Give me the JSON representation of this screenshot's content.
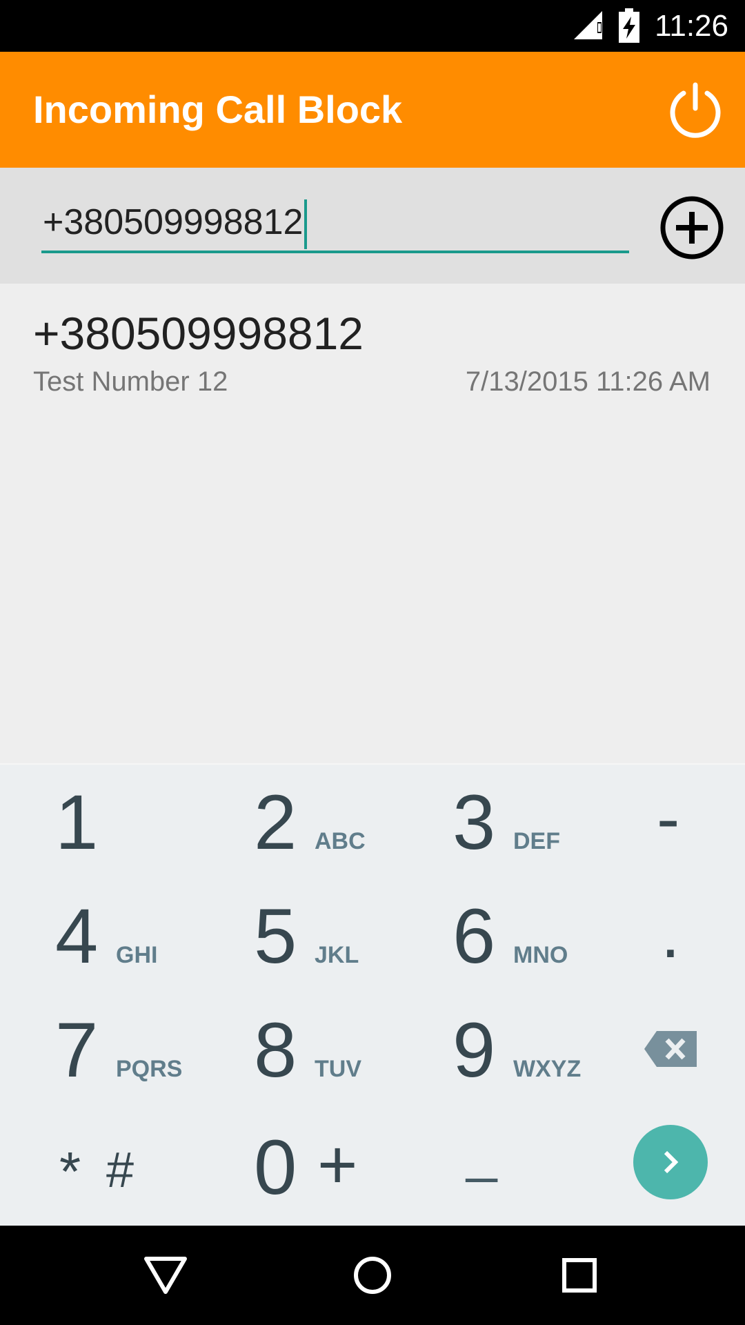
{
  "status_bar": {
    "time": "11:26"
  },
  "app_bar": {
    "title": "Incoming Call Block",
    "power_icon": "power-icon"
  },
  "input": {
    "value": "+380509998812",
    "add_icon": "add-circle-icon"
  },
  "list": [
    {
      "number": "+380509998812",
      "label": "Test Number 12",
      "date": "7/13/2015 11:26 AM"
    }
  ],
  "dialpad": {
    "keys": [
      {
        "digit": "1",
        "letters": ""
      },
      {
        "digit": "2",
        "letters": "ABC"
      },
      {
        "digit": "3",
        "letters": "DEF"
      },
      {
        "digit": "4",
        "letters": "GHI"
      },
      {
        "digit": "5",
        "letters": "JKL"
      },
      {
        "digit": "6",
        "letters": "MNO"
      },
      {
        "digit": "7",
        "letters": "PQRS"
      },
      {
        "digit": "8",
        "letters": "TUV"
      },
      {
        "digit": "9",
        "letters": "WXYZ"
      }
    ],
    "dash": "-",
    "dot": ".",
    "star": "*",
    "hash": "#",
    "zero": "0",
    "plus": "+",
    "underscore": "_",
    "backspace_icon": "backspace-icon",
    "go_icon": "chevron-right-icon",
    "colors": {
      "accent": "#4db6ac",
      "appbar": "#ff8c00",
      "underline": "#1a9a8c"
    }
  },
  "nav": {
    "back_icon": "back-icon",
    "home_icon": "home-icon",
    "recents_icon": "recents-icon"
  }
}
